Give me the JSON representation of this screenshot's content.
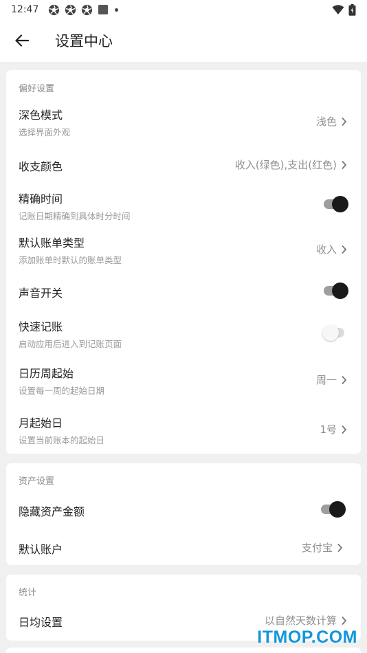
{
  "status_bar": {
    "time": "12:47"
  },
  "app_bar": {
    "title": "设置中心"
  },
  "preferences": {
    "section_title": "偏好设置",
    "dark_mode": {
      "label": "深色模式",
      "sub": "选择界面外观",
      "value": "浅色"
    },
    "income_expense_color": {
      "label": "收支颜色",
      "value": "收入(绿色),支出(红色)"
    },
    "precise_time": {
      "label": "精确时间",
      "sub": "记账日期精确到具体时分时间",
      "enabled": true
    },
    "default_bill_type": {
      "label": "默认账单类型",
      "sub": "添加账单时默认的账单类型",
      "value": "收入"
    },
    "sound": {
      "label": "声音开关",
      "enabled": true
    },
    "quick_record": {
      "label": "快速记账",
      "sub": "启动应用后进入到记账页面",
      "enabled": false
    },
    "week_start": {
      "label": "日历周起始",
      "sub": "设置每一周的起始日期",
      "value": "周一"
    },
    "month_start": {
      "label": "月起始日",
      "sub": "设置当前账本的起始日",
      "value": "1号"
    }
  },
  "assets": {
    "section_title": "资产设置",
    "hide_amount": {
      "label": "隐藏资产金额",
      "enabled": true
    },
    "default_account": {
      "label": "默认账户",
      "value": "支付宝"
    }
  },
  "stats": {
    "section_title": "统计",
    "daily_average": {
      "label": "日均设置",
      "value": "以自然天数计算"
    }
  },
  "watermark": "ITMOP.COM",
  "colors": {
    "toggle_on_thumb": "#1a1a1a",
    "toggle_on_track": "#9e9e9e",
    "toggle_off_track": "#dcdcdc",
    "watermark": "#1296db"
  }
}
